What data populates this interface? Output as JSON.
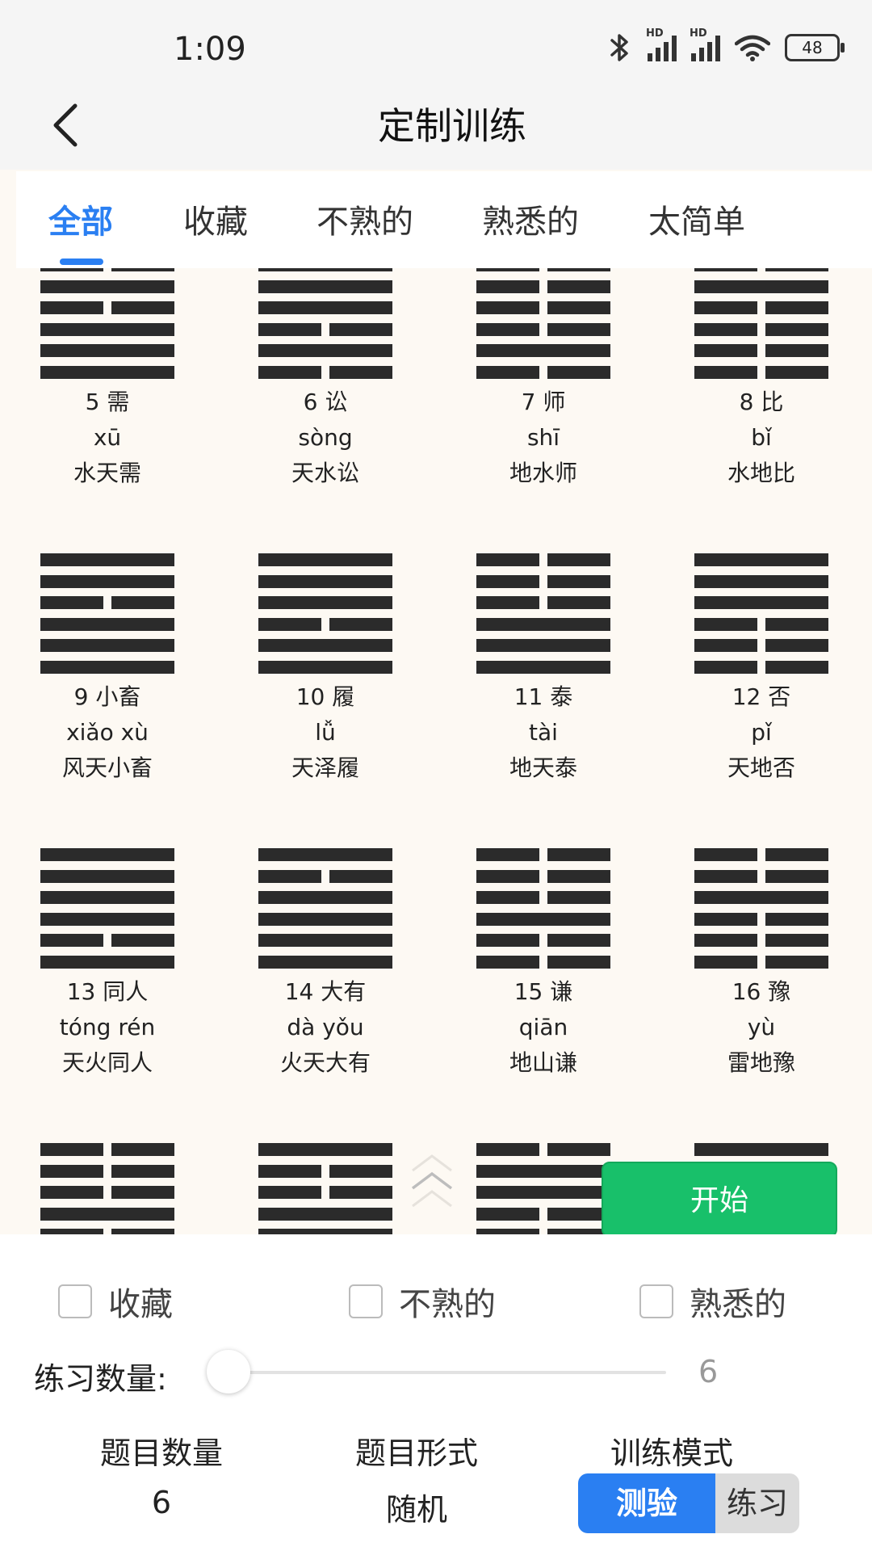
{
  "status_bar": {
    "time": "1:09",
    "battery": "48",
    "hd1": "HD",
    "hd2": "HD"
  },
  "header": {
    "title": "定制训练"
  },
  "tabs": [
    {
      "label": "全部",
      "active": true
    },
    {
      "label": "收藏",
      "active": false
    },
    {
      "label": "不熟的",
      "active": false
    },
    {
      "label": "熟悉的",
      "active": false
    },
    {
      "label": "太简单",
      "active": false
    }
  ],
  "hexagrams": [
    {
      "title": "5 需",
      "pinyin": "xū",
      "name": "水天需",
      "lines": [
        0,
        1,
        0,
        1,
        1,
        1
      ]
    },
    {
      "title": "6 讼",
      "pinyin": "sòng",
      "name": "天水讼",
      "lines": [
        1,
        1,
        1,
        0,
        1,
        0
      ]
    },
    {
      "title": "7 师",
      "pinyin": "shī",
      "name": "地水师",
      "lines": [
        0,
        0,
        0,
        0,
        1,
        0
      ]
    },
    {
      "title": "8 比",
      "pinyin": "bǐ",
      "name": "水地比",
      "lines": [
        0,
        1,
        0,
        0,
        0,
        0
      ]
    },
    {
      "title": "9 小畜",
      "pinyin": "xiǎo xù",
      "name": "风天小畜",
      "lines": [
        1,
        1,
        0,
        1,
        1,
        1
      ]
    },
    {
      "title": "10 履",
      "pinyin": "lǚ",
      "name": "天泽履",
      "lines": [
        1,
        1,
        1,
        0,
        1,
        1
      ]
    },
    {
      "title": "11 泰",
      "pinyin": "tài",
      "name": "地天泰",
      "lines": [
        0,
        0,
        0,
        1,
        1,
        1
      ]
    },
    {
      "title": "12 否",
      "pinyin": "pǐ",
      "name": "天地否",
      "lines": [
        1,
        1,
        1,
        0,
        0,
        0
      ]
    },
    {
      "title": "13 同人",
      "pinyin": "tóng rén",
      "name": "天火同人",
      "lines": [
        1,
        1,
        1,
        1,
        0,
        1
      ]
    },
    {
      "title": "14 大有",
      "pinyin": "dà yǒu",
      "name": "火天大有",
      "lines": [
        1,
        0,
        1,
        1,
        1,
        1
      ]
    },
    {
      "title": "15 谦",
      "pinyin": "qiān",
      "name": "地山谦",
      "lines": [
        0,
        0,
        0,
        1,
        0,
        0
      ]
    },
    {
      "title": "16 豫",
      "pinyin": "yù",
      "name": "雷地豫",
      "lines": [
        0,
        0,
        1,
        0,
        0,
        0
      ]
    },
    {
      "title": "",
      "pinyin": "",
      "name": "",
      "lines": [
        0,
        0,
        0,
        1,
        0,
        0
      ]
    },
    {
      "title": "",
      "pinyin": "",
      "name": "",
      "lines": [
        1,
        0,
        0,
        1,
        1,
        0
      ]
    },
    {
      "title": "",
      "pinyin": "",
      "name": "",
      "lines": [
        0,
        1,
        1,
        0,
        0,
        1
      ]
    },
    {
      "title": "",
      "pinyin": "",
      "name": "",
      "lines": [
        1,
        0,
        0,
        0,
        0,
        0
      ]
    }
  ],
  "actions": {
    "start_label": "开始"
  },
  "filters": {
    "favorite": "收藏",
    "unfamiliar": "不熟的",
    "familiar": "熟悉的"
  },
  "practice": {
    "label": "练习数量:",
    "value": "6",
    "level_fraction": 0.0
  },
  "summary": {
    "count_label": "题目数量",
    "count_value": "6",
    "format_label": "题目形式",
    "format_value": "随机",
    "mode_label": "训练模式"
  },
  "mode": {
    "quiz": "测验",
    "practice": "练习"
  },
  "colors": {
    "accent": "#2a7ff2",
    "start_green": "#18c06a",
    "background": "#fdf9f3"
  },
  "icons": {
    "back": "chevron-left-icon",
    "scroll_top": "double-chevron-up-icon"
  }
}
